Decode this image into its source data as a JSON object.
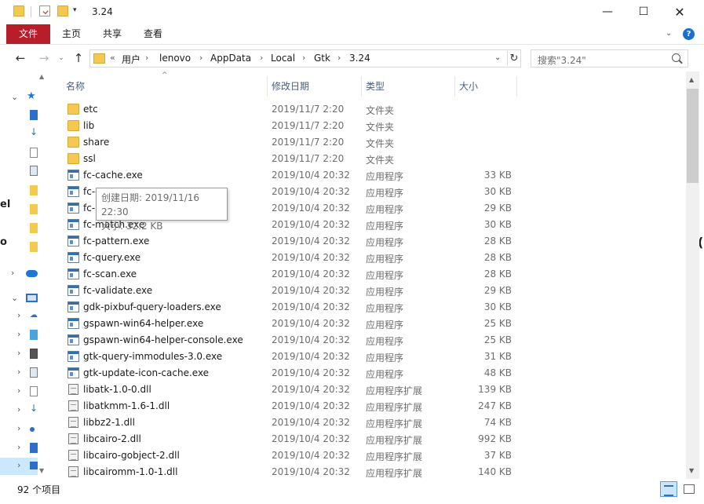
{
  "window": {
    "title": "3.24",
    "minimize": "—",
    "maximize": "☐",
    "close": "✕"
  },
  "quick_access": {
    "dropdown": "▾"
  },
  "ribbon": {
    "tabs": [
      "文件",
      "主页",
      "共享",
      "查看"
    ],
    "expand": "⌄",
    "help": "?"
  },
  "nav": {
    "back": "←",
    "forward": "→",
    "recent": "⌄",
    "up": "↑"
  },
  "address": {
    "overflow": "«",
    "crumbs": [
      "用户",
      "lenovo",
      "AppData",
      "Local",
      "Gtk",
      "3.24"
    ],
    "separator": "›",
    "dropdown": "⌄",
    "refresh": "↻"
  },
  "search": {
    "placeholder": "搜索\"3.24\""
  },
  "columns": {
    "name": "名称",
    "date": "修改日期",
    "type": "类型",
    "size": "大小"
  },
  "files": [
    {
      "name": "etc",
      "date": "2019/11/7 2:20",
      "type": "文件夹",
      "size": "",
      "kind": "folder"
    },
    {
      "name": "lib",
      "date": "2019/11/7 2:20",
      "type": "文件夹",
      "size": "",
      "kind": "folder"
    },
    {
      "name": "share",
      "date": "2019/11/7 2:20",
      "type": "文件夹",
      "size": "",
      "kind": "folder"
    },
    {
      "name": "ssl",
      "date": "2019/11/7 2:20",
      "type": "文件夹",
      "size": "",
      "kind": "folder"
    },
    {
      "name": "fc-cache.exe",
      "date": "2019/10/4 20:32",
      "type": "应用程序",
      "size": "33 KB",
      "kind": "exe"
    },
    {
      "name": "fc-cat.exe",
      "date": "2019/10/4 20:32",
      "type": "应用程序",
      "size": "30 KB",
      "kind": "exe"
    },
    {
      "name": "fc-list.exe",
      "date": "2019/10/4 20:32",
      "type": "应用程序",
      "size": "29 KB",
      "kind": "exe"
    },
    {
      "name": "fc-match.exe",
      "date": "2019/10/4 20:32",
      "type": "应用程序",
      "size": "30 KB",
      "kind": "exe"
    },
    {
      "name": "fc-pattern.exe",
      "date": "2019/10/4 20:32",
      "type": "应用程序",
      "size": "28 KB",
      "kind": "exe"
    },
    {
      "name": "fc-query.exe",
      "date": "2019/10/4 20:32",
      "type": "应用程序",
      "size": "28 KB",
      "kind": "exe"
    },
    {
      "name": "fc-scan.exe",
      "date": "2019/10/4 20:32",
      "type": "应用程序",
      "size": "28 KB",
      "kind": "exe"
    },
    {
      "name": "fc-validate.exe",
      "date": "2019/10/4 20:32",
      "type": "应用程序",
      "size": "29 KB",
      "kind": "exe"
    },
    {
      "name": "gdk-pixbuf-query-loaders.exe",
      "date": "2019/10/4 20:32",
      "type": "应用程序",
      "size": "30 KB",
      "kind": "exe"
    },
    {
      "name": "gspawn-win64-helper.exe",
      "date": "2019/10/4 20:32",
      "type": "应用程序",
      "size": "25 KB",
      "kind": "exe"
    },
    {
      "name": "gspawn-win64-helper-console.exe",
      "date": "2019/10/4 20:32",
      "type": "应用程序",
      "size": "25 KB",
      "kind": "exe"
    },
    {
      "name": "gtk-query-immodules-3.0.exe",
      "date": "2019/10/4 20:32",
      "type": "应用程序",
      "size": "31 KB",
      "kind": "exe"
    },
    {
      "name": "gtk-update-icon-cache.exe",
      "date": "2019/10/4 20:32",
      "type": "应用程序",
      "size": "48 KB",
      "kind": "exe"
    },
    {
      "name": "libatk-1.0-0.dll",
      "date": "2019/10/4 20:32",
      "type": "应用程序扩展",
      "size": "139 KB",
      "kind": "dll"
    },
    {
      "name": "libatkmm-1.6-1.dll",
      "date": "2019/10/4 20:32",
      "type": "应用程序扩展",
      "size": "247 KB",
      "kind": "dll"
    },
    {
      "name": "libbz2-1.dll",
      "date": "2019/10/4 20:32",
      "type": "应用程序扩展",
      "size": "74 KB",
      "kind": "dll"
    },
    {
      "name": "libcairo-2.dll",
      "date": "2019/10/4 20:32",
      "type": "应用程序扩展",
      "size": "992 KB",
      "kind": "dll"
    },
    {
      "name": "libcairo-gobject-2.dll",
      "date": "2019/10/4 20:32",
      "type": "应用程序扩展",
      "size": "37 KB",
      "kind": "dll"
    },
    {
      "name": "libcairomm-1.0-1.dll",
      "date": "2019/10/4 20:32",
      "type": "应用程序扩展",
      "size": "140 KB",
      "kind": "dll"
    }
  ],
  "tooltip": {
    "created": "创建日期: 2019/11/16 22:30",
    "size": "大小: 32.2 KB"
  },
  "status": {
    "item_count": "92 个项目"
  },
  "edge_glyphs": {
    "left_top": "el",
    "left_mid": "o",
    "right_mid": "("
  },
  "colors": {
    "file_tab": "#b81d2a",
    "folder": "#f3c94f",
    "selection": "#cce8ff",
    "header_text": "#4c607a"
  }
}
